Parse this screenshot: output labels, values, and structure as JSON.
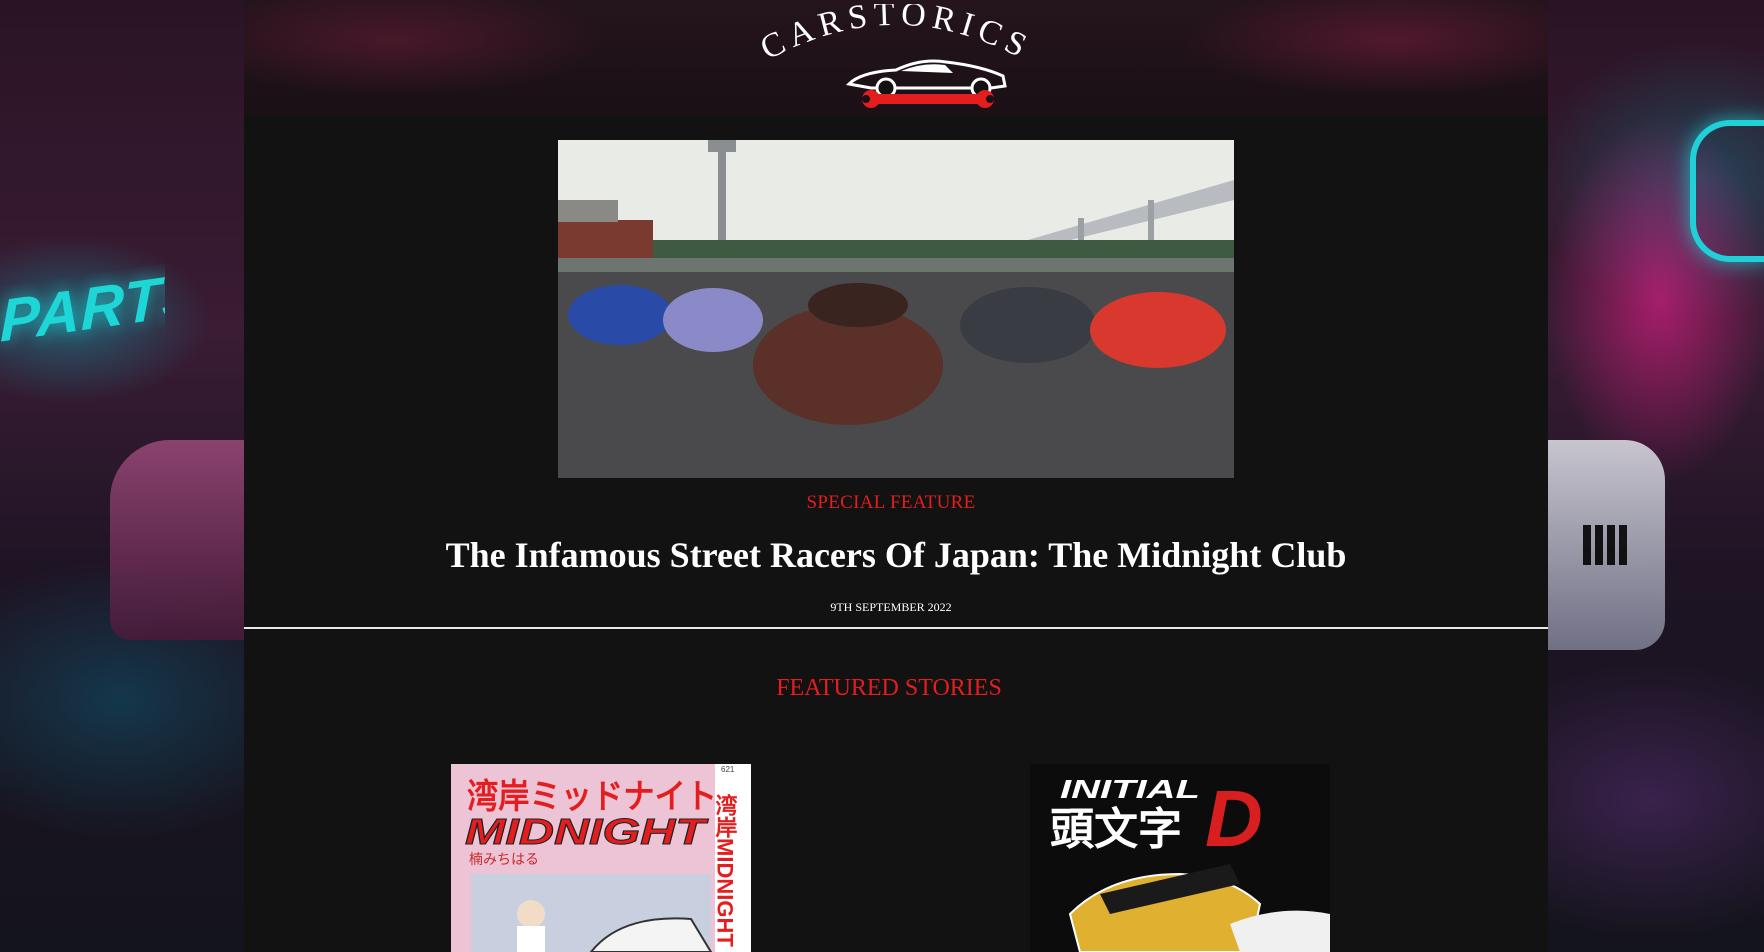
{
  "site": {
    "logo_text": "CARSTORICS",
    "logo_icon": "car-wrench-icon"
  },
  "hero": {
    "image_alt": "street-racing-cars-group-photo",
    "label": "SPECIAL FEATURE",
    "title": "The Infamous Street Racers Of Japan: The Midnight Club",
    "date": "9TH SEPTEMBER 2022"
  },
  "featured": {
    "heading": "FEATURED STORIES",
    "stories": [
      {
        "cover_title_jp": "湾岸ミッドナイト",
        "cover_title_en": "MIDNIGHT",
        "cover_author": "楠みちはる",
        "cover_spine": "湾岸MIDNIGHT",
        "cover_number": "621"
      },
      {
        "cover_title_top": "INITIAL",
        "cover_title_jp": "頭文字",
        "cover_title_letter": "D"
      }
    ]
  },
  "colors": {
    "accent": "#e41e1e",
    "page_bg": "#121212",
    "text": "#ffffff"
  }
}
